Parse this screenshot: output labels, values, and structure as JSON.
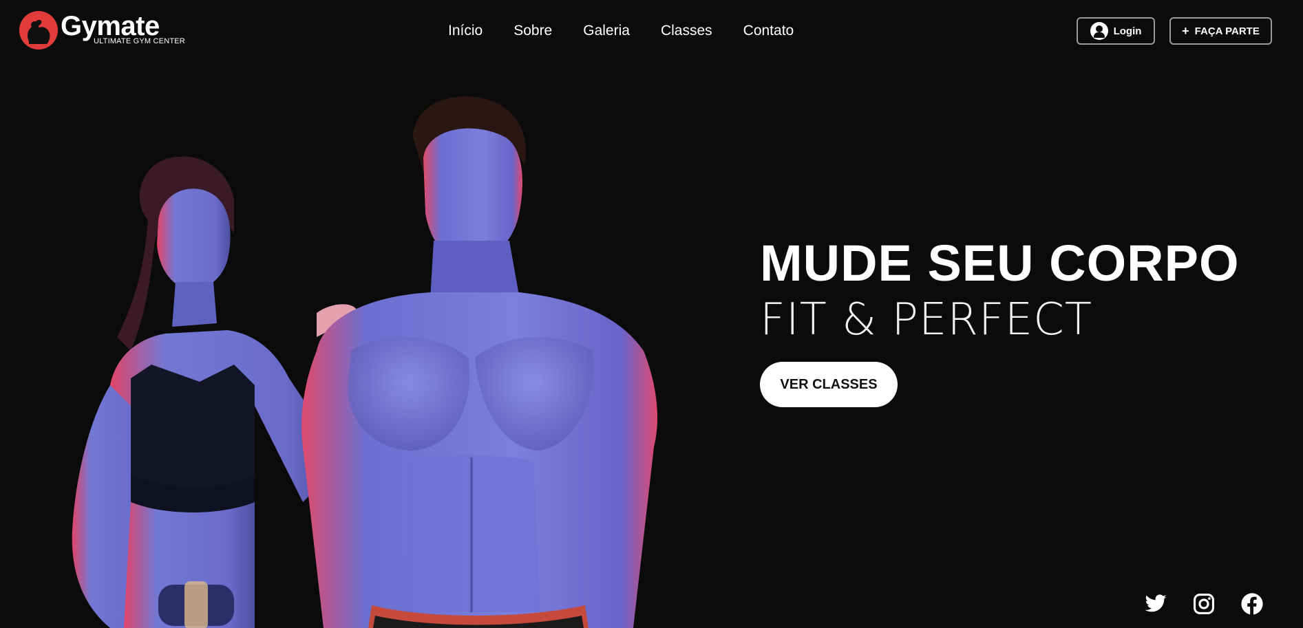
{
  "brand": {
    "name": "Gymate",
    "tagline": "ULTIMATE GYM CENTER",
    "logo_icon": "flexing-arm-icon",
    "accent_color": "#e23b3b"
  },
  "nav": {
    "items": [
      {
        "label": "Início"
      },
      {
        "label": "Sobre"
      },
      {
        "label": "Galeria"
      },
      {
        "label": "Classes"
      },
      {
        "label": "Contato"
      }
    ]
  },
  "header_actions": {
    "login_label": "Login",
    "login_icon": "user-circle-icon",
    "join_label": "FAÇA PARTE",
    "join_icon": "plus-icon"
  },
  "hero": {
    "title": "MUDE SEU CORPO",
    "subtitle": "FIT & PERFECT",
    "cta_label": "VER CLASSES",
    "background_color": "#0b0b0b"
  },
  "social": {
    "icons": [
      "twitter-icon",
      "instagram-icon",
      "facebook-icon"
    ]
  }
}
